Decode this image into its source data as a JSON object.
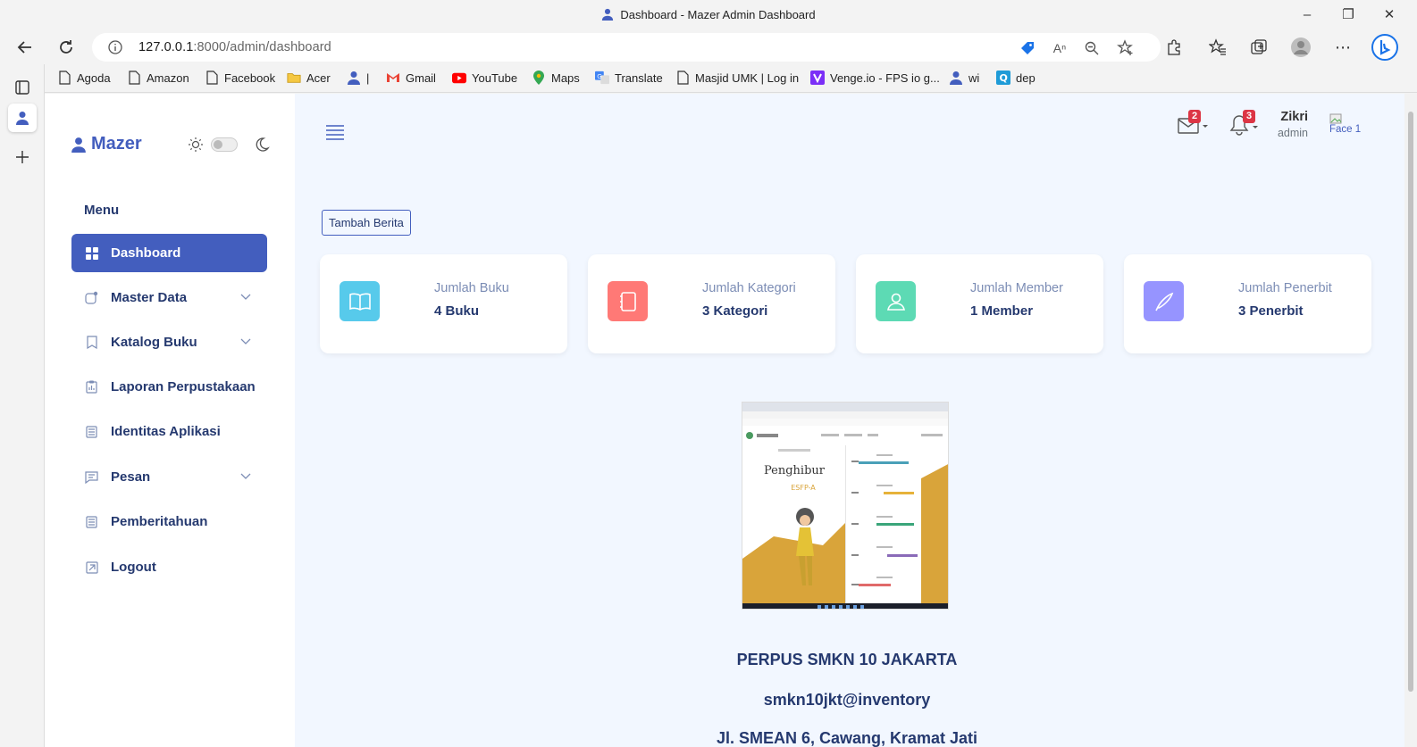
{
  "window": {
    "title": "Dashboard - Mazer Admin Dashboard",
    "controls": [
      "minimize",
      "restore",
      "close"
    ]
  },
  "browser": {
    "url_host": "127.0.0.1",
    "url_rest": ":8000/admin/dashboard",
    "bookmarks": [
      {
        "label": "Agoda",
        "icon": "page-icon"
      },
      {
        "label": "Amazon",
        "icon": "page-icon"
      },
      {
        "label": "Facebook",
        "icon": "page-icon"
      },
      {
        "label": "Acer",
        "icon": "folder-icon"
      },
      {
        "label": "|",
        "icon": "user-icon"
      },
      {
        "label": "Gmail",
        "icon": "gmail-icon"
      },
      {
        "label": "YouTube",
        "icon": "youtube-icon"
      },
      {
        "label": "Maps",
        "icon": "maps-icon"
      },
      {
        "label": "Translate",
        "icon": "translate-icon"
      },
      {
        "label": "Masjid UMK | Log in",
        "icon": "page-icon"
      },
      {
        "label": "Venge.io - FPS io g...",
        "icon": "venge-icon"
      },
      {
        "label": "wi",
        "icon": "user-icon"
      },
      {
        "label": "dep",
        "icon": "q-icon"
      }
    ]
  },
  "sidebar": {
    "brand": "Mazer",
    "menu_title": "Menu",
    "items": [
      {
        "label": "Dashboard",
        "icon": "grid-icon",
        "active": true,
        "has_submenu": false
      },
      {
        "label": "Master Data",
        "icon": "stack-icon",
        "active": false,
        "has_submenu": true
      },
      {
        "label": "Katalog Buku",
        "icon": "bookmark-icon",
        "active": false,
        "has_submenu": true
      },
      {
        "label": "Laporan Perpustakaan",
        "icon": "clipboard-icon",
        "active": false,
        "has_submenu": false
      },
      {
        "label": "Identitas Aplikasi",
        "icon": "document-icon",
        "active": false,
        "has_submenu": false
      },
      {
        "label": "Pesan",
        "icon": "message-icon",
        "active": false,
        "has_submenu": true
      },
      {
        "label": "Pemberitahuan",
        "icon": "document-icon",
        "active": false,
        "has_submenu": false
      },
      {
        "label": "Logout",
        "icon": "logout-icon",
        "active": false,
        "has_submenu": false
      }
    ]
  },
  "header": {
    "mail_count": "2",
    "notif_count": "3",
    "user_name": "Zikri",
    "user_role": "admin",
    "avatar_alt": "Face 1"
  },
  "main": {
    "add_news_button": "Tambah Berita",
    "stats": [
      {
        "label": "Jumlah Buku",
        "value": "4 Buku",
        "color": "#57caeb",
        "icon": "book-icon"
      },
      {
        "label": "Jumlah Kategori",
        "value": "3 Kategori",
        "color": "#ff7976",
        "icon": "journal-icon"
      },
      {
        "label": "Jumlah Member",
        "value": "1 Member",
        "color": "#5ddab4",
        "icon": "person-icon"
      },
      {
        "label": "Jumlah Penerbit",
        "value": "3 Penerbit",
        "color": "#9694ff",
        "icon": "pen-icon"
      }
    ],
    "image": {
      "heading": "Penghibur",
      "subheading": "ESFP-A"
    },
    "school_name": "PERPUS SMKN 10 JAKARTA",
    "email": "smkn10jkt@inventory",
    "address": "Jl. SMEAN 6, Cawang, Kramat Jati"
  }
}
